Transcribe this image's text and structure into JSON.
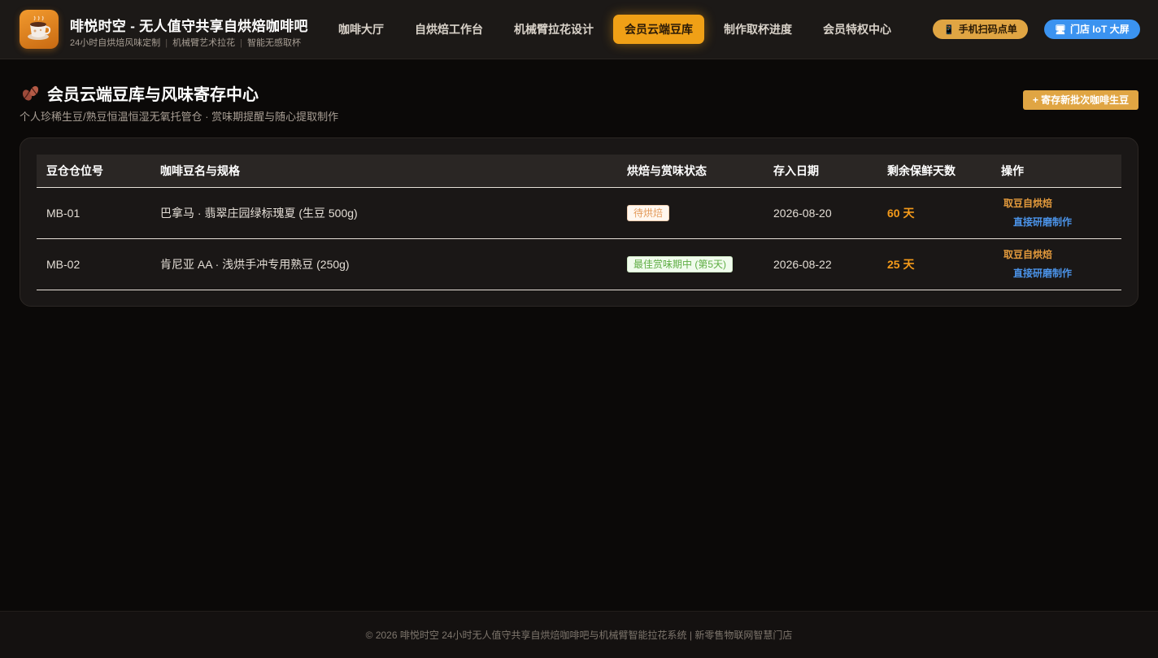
{
  "header": {
    "brand_title": "啡悦时空 - 无人值守共享自烘焙咖啡吧",
    "brand_sub": [
      "24小时自烘焙风味定制",
      "机械臂艺术拉花",
      "智能无感取杯"
    ],
    "logo_icon": "coffee-cup-icon",
    "nav": [
      {
        "label": "咖啡大厅",
        "active": false
      },
      {
        "label": "自烘焙工作台",
        "active": false
      },
      {
        "label": "机械臂拉花设计",
        "active": false
      },
      {
        "label": "会员云端豆库",
        "active": true
      },
      {
        "label": "制作取杯进度",
        "active": false
      },
      {
        "label": "会员特权中心",
        "active": false
      }
    ],
    "scan_label": "手机扫码点单",
    "scan_icon": "phone-icon",
    "iot_label": "门店 IoT 大屏",
    "iot_icon": "monitor-icon"
  },
  "page": {
    "title": "会员云端豆库与风味寄存中心",
    "title_icon": "coffee-bean-icon",
    "subtitle": "个人珍稀生豆/熟豆恒温恒湿无氧托管仓 · 赏味期提醒与随心提取制作",
    "deposit_button": "+ 寄存新批次咖啡生豆"
  },
  "table": {
    "columns": [
      "豆仓仓位号",
      "咖啡豆名与规格",
      "烘焙与赏味状态",
      "存入日期",
      "剩余保鲜天数",
      "操作"
    ],
    "rows": [
      {
        "slot": "MB-01",
        "name": "巴拿马 · 翡翠庄园绿标瑰夏 (生豆 500g)",
        "status": "待烘焙",
        "status_type": "pending",
        "date": "2026-08-20",
        "days": "60 天",
        "action_take": "取豆自烘焙",
        "action_grind": "直接研磨制作"
      },
      {
        "slot": "MB-02",
        "name": "肯尼亚 AA · 浅烘手冲专用熟豆 (250g)",
        "status": "最佳赏味期中 (第5天)",
        "status_type": "best",
        "date": "2026-08-22",
        "days": "25 天",
        "action_take": "取豆自烘焙",
        "action_grind": "直接研磨制作"
      }
    ]
  },
  "footer": {
    "text": "© 2026 啡悦时空 24小时无人值守共享自烘焙咖啡吧与机械臂智能拉花系统 | 新零售物联网智慧门店"
  },
  "colors": {
    "accent": "#f0a016",
    "background": "#0b0908",
    "card": "#1a1716",
    "link_blue": "#4b93e8",
    "days_orange": "#f49a1a"
  }
}
